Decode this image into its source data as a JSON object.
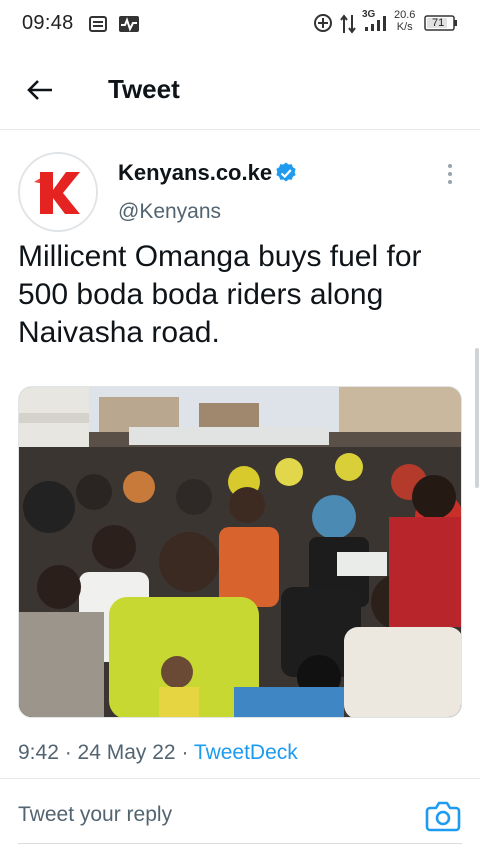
{
  "status_bar": {
    "time": "09:48",
    "network": "3G",
    "speed_value": "20.6",
    "speed_unit": "K/s",
    "battery": "71"
  },
  "header": {
    "title": "Tweet"
  },
  "tweet": {
    "author_name": "Kenyans.co.ke",
    "author_handle": "@Kenyans",
    "text": "Millicent Omanga buys fuel for 500 boda boda riders along Naivasha road.",
    "time": "9:42",
    "date": "24 May 22",
    "source": "TweetDeck",
    "separator": " · "
  },
  "reply": {
    "placeholder": "Tweet your reply"
  },
  "colors": {
    "accent": "#1d9bf0",
    "logo_red": "#e52421",
    "secondary_text": "#536471"
  },
  "icons": [
    "back-arrow-icon",
    "verified-badge-icon",
    "more-vertical-icon",
    "camera-icon"
  ]
}
